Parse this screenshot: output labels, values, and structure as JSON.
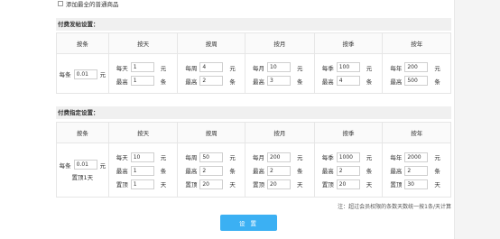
{
  "top": {
    "checkbox_label": "添加最全的普通商品"
  },
  "section1": {
    "title": "付费发帖设置：",
    "headers": [
      "按条",
      "按天",
      "按周",
      "按月",
      "按季",
      "按年"
    ],
    "per_item": {
      "prefix": "每条",
      "value": "0.01",
      "unit": "元"
    },
    "periods": [
      {
        "price_label": "每天",
        "price": "1",
        "price_unit": "元",
        "max_label": "最高",
        "max": "1",
        "max_unit": "条"
      },
      {
        "price_label": "每周",
        "price": "4",
        "price_unit": "元",
        "max_label": "最高",
        "max": "2",
        "max_unit": "条"
      },
      {
        "price_label": "每月",
        "price": "10",
        "price_unit": "元",
        "max_label": "最高",
        "max": "3",
        "max_unit": "条"
      },
      {
        "price_label": "每季",
        "price": "100",
        "price_unit": "元",
        "max_label": "最高",
        "max": "4",
        "max_unit": "条"
      },
      {
        "price_label": "每年",
        "price": "200",
        "price_unit": "元",
        "max_label": "最高",
        "max": "500",
        "max_unit": "条"
      }
    ]
  },
  "section2": {
    "title": "付费指定设置：",
    "headers": [
      "按条",
      "按天",
      "按周",
      "按月",
      "按季",
      "按年"
    ],
    "per_item": {
      "prefix": "每条",
      "value": "0.01",
      "unit": "元",
      "sub": "置顶1天"
    },
    "periods": [
      {
        "price_label": "每天",
        "price": "10",
        "price_unit": "元",
        "max_label": "最高",
        "max": "1",
        "max_unit": "条",
        "top_label": "置顶",
        "top": "1",
        "top_unit": "天"
      },
      {
        "price_label": "每周",
        "price": "50",
        "price_unit": "元",
        "max_label": "最高",
        "max": "2",
        "max_unit": "条",
        "top_label": "置顶",
        "top": "20",
        "top_unit": "天"
      },
      {
        "price_label": "每月",
        "price": "200",
        "price_unit": "元",
        "max_label": "最高",
        "max": "2",
        "max_unit": "条",
        "top_label": "置顶",
        "top": "20",
        "top_unit": "天"
      },
      {
        "price_label": "每季",
        "price": "1000",
        "price_unit": "元",
        "max_label": "最高",
        "max": "2",
        "max_unit": "条",
        "top_label": "置顶",
        "top": "20",
        "top_unit": "天"
      },
      {
        "price_label": "每年",
        "price": "2000",
        "price_unit": "元",
        "max_label": "最高",
        "max": "2",
        "max_unit": "条",
        "top_label": "置顶",
        "top": "30",
        "top_unit": "天"
      }
    ]
  },
  "note": "注：超过会员权限的条数天数统一按1条/天计算",
  "submit_label": "设 置"
}
